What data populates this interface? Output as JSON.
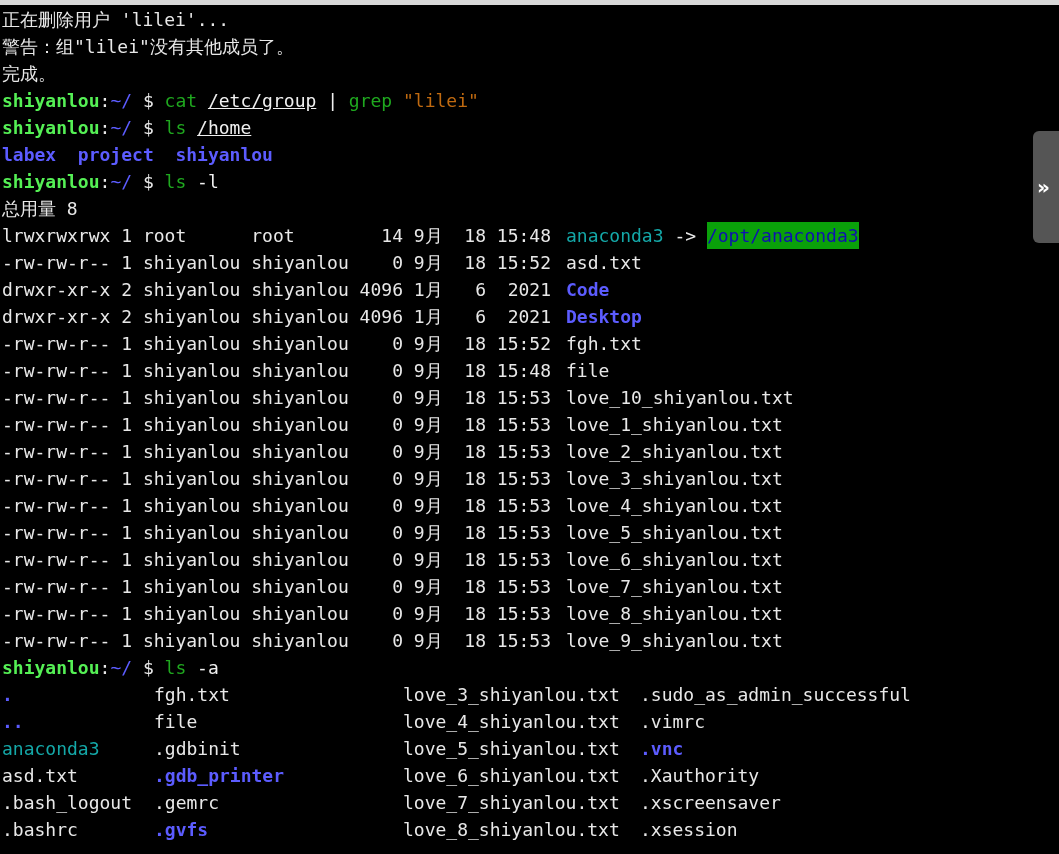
{
  "terminal": {
    "lines": [
      {
        "kind": "message",
        "text": "正在删除用户 'lilei'..."
      },
      {
        "kind": "message",
        "text": "警告：组\"lilei\"没有其他成员了。"
      },
      {
        "kind": "message",
        "text": "完成。"
      },
      {
        "kind": "prompt",
        "prompt": {
          "user": "shiyanlou",
          "separator": ":",
          "path": "~/",
          "symbol": "$"
        },
        "tokens": [
          {
            "kind": "command",
            "text": "cat"
          },
          {
            "kind": "path",
            "text": "/etc/group"
          },
          {
            "kind": "operator",
            "text": "|"
          },
          {
            "kind": "command",
            "text": "grep"
          },
          {
            "kind": "string",
            "text": "\"lilei\""
          }
        ]
      },
      {
        "kind": "prompt",
        "prompt": {
          "user": "shiyanlou",
          "separator": ":",
          "path": "~/",
          "symbol": "$"
        },
        "tokens": [
          {
            "kind": "command",
            "text": "ls"
          },
          {
            "kind": "path",
            "text": "/home"
          }
        ]
      },
      {
        "kind": "names",
        "entries": [
          {
            "text": "labex",
            "kind": "directory"
          },
          {
            "text": "project",
            "kind": "directory"
          },
          {
            "text": "shiyanlou",
            "kind": "directory"
          }
        ]
      },
      {
        "kind": "prompt",
        "prompt": {
          "user": "shiyanlou",
          "separator": ":",
          "path": "~/",
          "symbol": "$"
        },
        "tokens": [
          {
            "kind": "command",
            "text": "ls"
          },
          {
            "kind": "option",
            "text": "-l"
          }
        ]
      },
      {
        "kind": "message",
        "text": "总用量 8"
      },
      {
        "kind": "long_listing",
        "rows": [
          {
            "meta": "lrwxrwxrwx 1 root      root        14 9月  18 15:48",
            "name": "anaconda3",
            "kind": "symlink",
            "arrow": "->",
            "target": "/opt/anaconda3"
          },
          {
            "meta": "-rw-rw-r-- 1 shiyanlou shiyanlou    0 9月  18 15:52",
            "name": "asd.txt",
            "kind": "file"
          },
          {
            "meta": "drwxr-xr-x 2 shiyanlou shiyanlou 4096 1月   6  2021",
            "name": "Code",
            "kind": "directory"
          },
          {
            "meta": "drwxr-xr-x 2 shiyanlou shiyanlou 4096 1月   6  2021",
            "name": "Desktop",
            "kind": "directory"
          },
          {
            "meta": "-rw-rw-r-- 1 shiyanlou shiyanlou    0 9月  18 15:52",
            "name": "fgh.txt",
            "kind": "file"
          },
          {
            "meta": "-rw-rw-r-- 1 shiyanlou shiyanlou    0 9月  18 15:48",
            "name": "file",
            "kind": "file"
          },
          {
            "meta": "-rw-rw-r-- 1 shiyanlou shiyanlou    0 9月  18 15:53",
            "name": "love_10_shiyanlou.txt",
            "kind": "file"
          },
          {
            "meta": "-rw-rw-r-- 1 shiyanlou shiyanlou    0 9月  18 15:53",
            "name": "love_1_shiyanlou.txt",
            "kind": "file"
          },
          {
            "meta": "-rw-rw-r-- 1 shiyanlou shiyanlou    0 9月  18 15:53",
            "name": "love_2_shiyanlou.txt",
            "kind": "file"
          },
          {
            "meta": "-rw-rw-r-- 1 shiyanlou shiyanlou    0 9月  18 15:53",
            "name": "love_3_shiyanlou.txt",
            "kind": "file"
          },
          {
            "meta": "-rw-rw-r-- 1 shiyanlou shiyanlou    0 9月  18 15:53",
            "name": "love_4_shiyanlou.txt",
            "kind": "file"
          },
          {
            "meta": "-rw-rw-r-- 1 shiyanlou shiyanlou    0 9月  18 15:53",
            "name": "love_5_shiyanlou.txt",
            "kind": "file"
          },
          {
            "meta": "-rw-rw-r-- 1 shiyanlou shiyanlou    0 9月  18 15:53",
            "name": "love_6_shiyanlou.txt",
            "kind": "file"
          },
          {
            "meta": "-rw-rw-r-- 1 shiyanlou shiyanlou    0 9月  18 15:53",
            "name": "love_7_shiyanlou.txt",
            "kind": "file"
          },
          {
            "meta": "-rw-rw-r-- 1 shiyanlou shiyanlou    0 9月  18 15:53",
            "name": "love_8_shiyanlou.txt",
            "kind": "file"
          },
          {
            "meta": "-rw-rw-r-- 1 shiyanlou shiyanlou    0 9月  18 15:53",
            "name": "love_9_shiyanlou.txt",
            "kind": "file"
          }
        ]
      },
      {
        "kind": "prompt",
        "prompt": {
          "user": "shiyanlou",
          "separator": ":",
          "path": "~/",
          "symbol": "$"
        },
        "tokens": [
          {
            "kind": "command",
            "text": "ls"
          },
          {
            "kind": "option",
            "text": "-a"
          }
        ]
      },
      {
        "kind": "columns",
        "columns": [
          [
            {
              "text": ".",
              "kind": "directory"
            },
            {
              "text": "..",
              "kind": "directory"
            },
            {
              "text": "anaconda3",
              "kind": "symlink"
            },
            {
              "text": "asd.txt",
              "kind": "file"
            },
            {
              "text": ".bash_logout",
              "kind": "file"
            },
            {
              "text": ".bashrc",
              "kind": "file"
            }
          ],
          [
            {
              "text": "fgh.txt",
              "kind": "file"
            },
            {
              "text": "file",
              "kind": "file"
            },
            {
              "text": ".gdbinit",
              "kind": "file"
            },
            {
              "text": ".gdb_printer",
              "kind": "directory"
            },
            {
              "text": ".gemrc",
              "kind": "file"
            },
            {
              "text": ".gvfs",
              "kind": "directory"
            }
          ],
          [
            {
              "text": "love_3_shiyanlou.txt",
              "kind": "file"
            },
            {
              "text": "love_4_shiyanlou.txt",
              "kind": "file"
            },
            {
              "text": "love_5_shiyanlou.txt",
              "kind": "file"
            },
            {
              "text": "love_6_shiyanlou.txt",
              "kind": "file"
            },
            {
              "text": "love_7_shiyanlou.txt",
              "kind": "file"
            },
            {
              "text": "love_8_shiyanlou.txt",
              "kind": "file"
            }
          ],
          [
            {
              "text": ".sudo_as_admin_successful",
              "kind": "file"
            },
            {
              "text": ".vimrc",
              "kind": "file"
            },
            {
              "text": ".vnc",
              "kind": "directory"
            },
            {
              "text": ".Xauthority",
              "kind": "file"
            },
            {
              "text": ".xscreensaver",
              "kind": "file"
            },
            {
              "text": ".xsession",
              "kind": "file"
            }
          ]
        ]
      }
    ]
  },
  "side_toggle": {
    "label": "»"
  }
}
